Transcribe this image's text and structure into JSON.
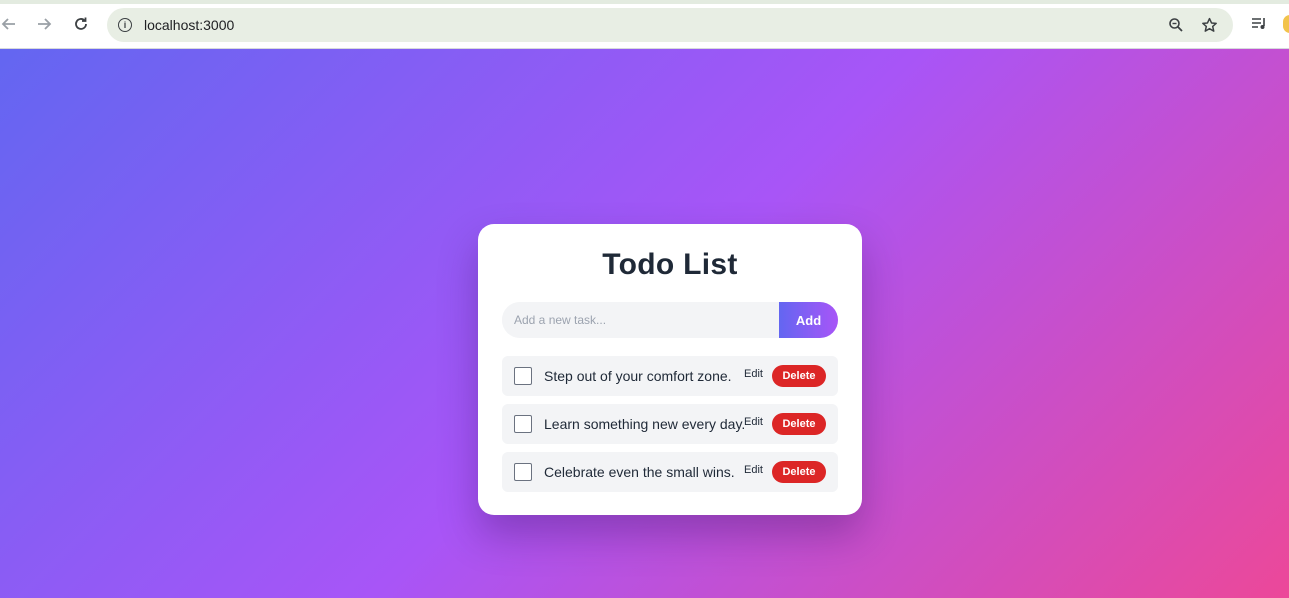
{
  "browser": {
    "url": "localhost:3000",
    "icons": {
      "back": "arrow-left-icon",
      "forward": "arrow-right-icon",
      "reload": "reload-icon",
      "site_info": "info-icon",
      "zoom": "zoom-out-icon",
      "bookmark": "star-icon",
      "media": "media-playlist-icon"
    }
  },
  "app": {
    "title": "Todo List",
    "input": {
      "placeholder": "Add a new task...",
      "value": ""
    },
    "add_label": "Add",
    "todos": [
      {
        "text": "Step out of your comfort zone.",
        "done": false,
        "edit_label": "Edit",
        "delete_label": "Delete"
      },
      {
        "text": "Learn something new every day.",
        "done": false,
        "edit_label": "Edit",
        "delete_label": "Delete"
      },
      {
        "text": "Celebrate even the small wins.",
        "done": false,
        "edit_label": "Edit",
        "delete_label": "Delete"
      }
    ]
  },
  "colors": {
    "gradient_start": "#6366f1",
    "gradient_mid": "#a855f7",
    "gradient_end": "#ec4899",
    "delete": "#dc2626",
    "title": "#1f2937"
  }
}
